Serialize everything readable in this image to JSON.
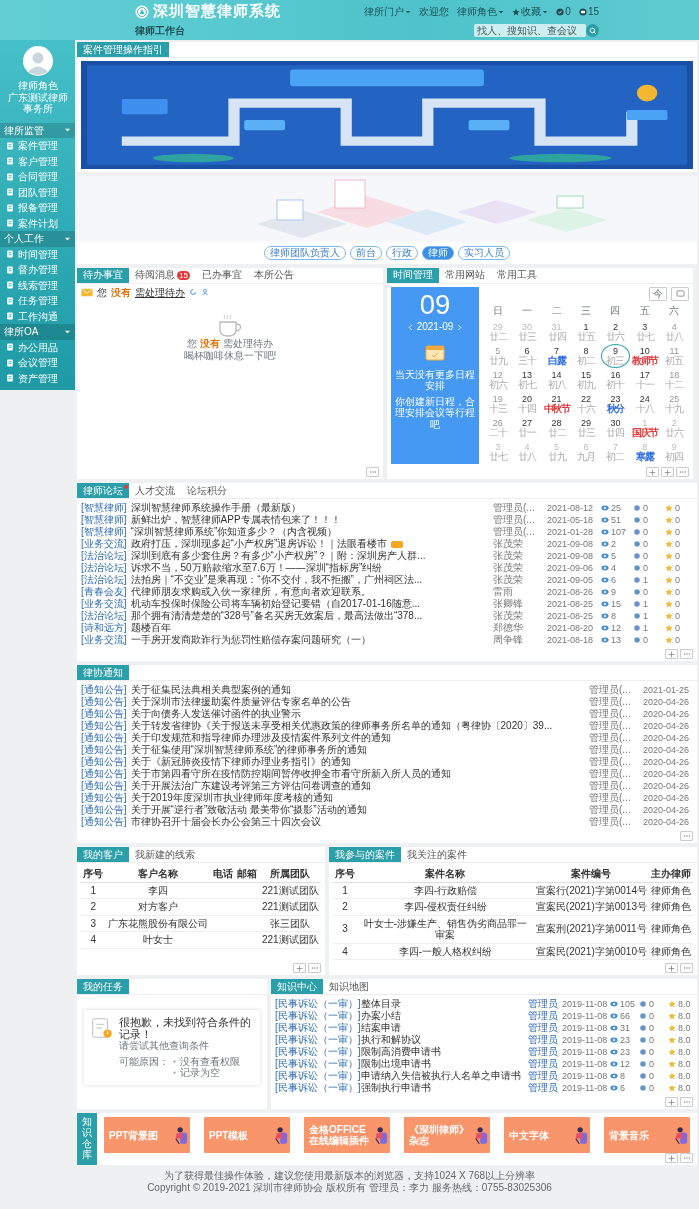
{
  "header": {
    "logo": "深圳智慧律师系统",
    "workbench": "律师工作台",
    "links": [
      {
        "kind": "menu",
        "label": "律所门户"
      },
      {
        "kind": "text",
        "label": "欢迎您"
      },
      {
        "kind": "menu",
        "label": "律师角色"
      },
      {
        "kind": "favorites",
        "label": "收藏"
      },
      {
        "kind": "tasks",
        "label": "0"
      },
      {
        "kind": "messages",
        "label": "15"
      }
    ],
    "search": {
      "placeholder": "找人、搜知识、查会议"
    }
  },
  "sidebar": {
    "user": {
      "name": "律师角色",
      "org": "广东测试律师事务所"
    },
    "groups": [
      {
        "label": "律所监管",
        "expanded": true,
        "items": [
          "案件管理",
          "客户管理",
          "合同管理",
          "团队管理",
          "报备管理",
          "案件计划"
        ]
      },
      {
        "label": "个人工作",
        "expanded": true,
        "items": [
          "时间管理",
          "督办管理",
          "线索管理",
          "任务管理",
          "工作沟通"
        ]
      },
      {
        "label": "律所OA",
        "expanded": true,
        "items": [
          "办公用品",
          "会议管理",
          "资产管理"
        ]
      }
    ]
  },
  "guide": {
    "tabs": [
      {
        "label": "案件管理操作指引",
        "selected": true
      }
    ]
  },
  "roles": [
    {
      "label": "律师团队负责人",
      "selected": false
    },
    {
      "label": "前台",
      "selected": false
    },
    {
      "label": "行政",
      "selected": false
    },
    {
      "label": "律师",
      "selected": true
    },
    {
      "label": "实习人员",
      "selected": false
    }
  ],
  "todo": {
    "tabs": [
      {
        "label": "待办事宜",
        "selected": true
      },
      {
        "label": "待阅消息",
        "selected": false,
        "badge": "15"
      },
      {
        "label": "已办事宜",
        "selected": false
      },
      {
        "label": "本所公告",
        "selected": false
      }
    ],
    "summary": {
      "prefix": "您",
      "count": "没有",
      "link": "需处理待办"
    },
    "empty": [
      "您 **没有** 需处理待办",
      "喝杯咖啡休息一下吧!"
    ]
  },
  "time": {
    "tabs": [
      {
        "label": "时间管理",
        "selected": true
      },
      {
        "label": "常用网站",
        "selected": false
      },
      {
        "label": "常用工具",
        "selected": false
      }
    ],
    "day": "09",
    "month": "2021-09",
    "empty": [
      "当天没有更多日程安排",
      "你创建新日程，合理安排会议等行程吧"
    ],
    "today_button": "今",
    "weekdays": [
      "日",
      "一",
      "二",
      "三",
      "四",
      "五",
      "六"
    ],
    "days": [
      {
        "day": "29",
        "lunar": "廿二",
        "kind": "other",
        "selected": false
      },
      {
        "day": "30",
        "lunar": "廿三",
        "kind": "other",
        "selected": false
      },
      {
        "day": "31",
        "lunar": "廿四",
        "kind": "other",
        "selected": false
      },
      {
        "day": "1",
        "lunar": "廿五",
        "kind": "weekday",
        "selected": false
      },
      {
        "day": "2",
        "lunar": "廿六",
        "kind": "weekday",
        "selected": false
      },
      {
        "day": "3",
        "lunar": "廿七",
        "kind": "weekday",
        "selected": false
      },
      {
        "day": "4",
        "lunar": "廿八",
        "kind": "weekend",
        "selected": false
      },
      {
        "day": "5",
        "lunar": "廿九",
        "kind": "weekend",
        "selected": false
      },
      {
        "day": "6",
        "lunar": "三十",
        "kind": "weekday",
        "selected": false
      },
      {
        "day": "7",
        "lunar": "白露",
        "kind": "weekday",
        "color": "#2d6cdf",
        "selected": false
      },
      {
        "day": "8",
        "lunar": "初二",
        "kind": "weekday",
        "selected": false
      },
      {
        "day": "9",
        "lunar": "初三",
        "kind": "weekday",
        "selected": true
      },
      {
        "day": "10",
        "lunar": "教师节",
        "kind": "weekday",
        "color": "#e4393c",
        "selected": false
      },
      {
        "day": "11",
        "lunar": "初五",
        "kind": "weekend",
        "selected": false
      },
      {
        "day": "12",
        "lunar": "初六",
        "kind": "weekend",
        "selected": false
      },
      {
        "day": "13",
        "lunar": "初七",
        "kind": "weekday",
        "selected": false
      },
      {
        "day": "14",
        "lunar": "初八",
        "kind": "weekday",
        "selected": false
      },
      {
        "day": "15",
        "lunar": "初九",
        "kind": "weekday",
        "selected": false
      },
      {
        "day": "16",
        "lunar": "初十",
        "kind": "weekday",
        "selected": false
      },
      {
        "day": "17",
        "lunar": "十一",
        "kind": "weekday",
        "selected": false
      },
      {
        "day": "18",
        "lunar": "十二",
        "kind": "weekend",
        "selected": false
      },
      {
        "day": "19",
        "lunar": "十三",
        "kind": "weekend",
        "selected": false
      },
      {
        "day": "20",
        "lunar": "十四",
        "kind": "weekday",
        "selected": false
      },
      {
        "day": "21",
        "lunar": "中秋节",
        "kind": "weekday",
        "color": "#e4393c",
        "selected": false
      },
      {
        "day": "22",
        "lunar": "十六",
        "kind": "weekday",
        "selected": false
      },
      {
        "day": "23",
        "lunar": "秋分",
        "kind": "weekday",
        "color": "#2d6cdf",
        "selected": false
      },
      {
        "day": "24",
        "lunar": "十八",
        "kind": "weekday",
        "selected": false
      },
      {
        "day": "25",
        "lunar": "十九",
        "kind": "weekend",
        "selected": false
      },
      {
        "day": "26",
        "lunar": "二十",
        "kind": "weekend",
        "selected": false
      },
      {
        "day": "27",
        "lunar": "廿一",
        "kind": "weekday",
        "selected": false
      },
      {
        "day": "28",
        "lunar": "廿二",
        "kind": "weekday",
        "selected": false
      },
      {
        "day": "29",
        "lunar": "廿三",
        "kind": "weekday",
        "selected": false
      },
      {
        "day": "30",
        "lunar": "廿四",
        "kind": "weekday",
        "selected": false
      },
      {
        "day": "1",
        "lunar": "国庆节",
        "kind": "other",
        "color": "#e4393c",
        "selected": false
      },
      {
        "day": "2",
        "lunar": "廿六",
        "kind": "other",
        "selected": false
      },
      {
        "day": "3",
        "lunar": "廿七",
        "kind": "other",
        "selected": false
      },
      {
        "day": "4",
        "lunar": "廿八",
        "kind": "other",
        "selected": false
      },
      {
        "day": "5",
        "lunar": "廿九",
        "kind": "other",
        "selected": false
      },
      {
        "day": "6",
        "lunar": "九月",
        "kind": "other",
        "selected": false
      },
      {
        "day": "7",
        "lunar": "初二",
        "kind": "other",
        "selected": false
      },
      {
        "day": "8",
        "lunar": "寒露",
        "kind": "other",
        "color": "#2d6cdf",
        "selected": false
      },
      {
        "day": "9",
        "lunar": "初四",
        "kind": "other",
        "selected": false
      }
    ]
  },
  "forum": {
    "tabs": [
      {
        "label": "律师论坛",
        "selected": true,
        "dot": true
      },
      {
        "label": "人才交流",
        "selected": false
      },
      {
        "label": "论坛积分",
        "selected": false
      }
    ],
    "rows": [
      {
        "category": "[智慧律师]",
        "title": "深圳智慧律师系统操作手册（最新版）",
        "author": "管理员(...",
        "date": "2021-08-12",
        "views": "25",
        "replies": "0",
        "score": "0"
      },
      {
        "category": "[智慧律师]",
        "title": "新鲜出炉，智慧律师APP专属表情包来了！！！",
        "author": "管理员(...",
        "date": "2021-05-18",
        "views": "51",
        "replies": "0",
        "score": "0"
      },
      {
        "category": "[智慧律师]",
        "title": "“深圳智慧律师系统”你知道多少？（内含视频）",
        "author": "管理员(...",
        "date": "2021-01-28",
        "views": "107",
        "replies": "0",
        "score": "0"
      },
      {
        "category": "[业务交流]",
        "title": "政府打压，深圳现多起“小产权房”退房诉讼！｜法眼看楼市",
        "author": "张茂荣",
        "date": "2021-09-08",
        "views": "2",
        "replies": "0",
        "score": "0",
        "hot": true
      },
      {
        "category": "[法治论坛]",
        "title": "深圳到底有多少套住房？有多少“小产权房”？｜附：深圳房产人群...",
        "author": "张茂荣",
        "date": "2021-09-08",
        "views": "5",
        "replies": "0",
        "score": "0"
      },
      {
        "category": "[法治论坛]",
        "title": "诉求不当，50万赔款缩水至7.6万！——深圳“指标房”纠纷",
        "author": "张茂荣",
        "date": "2021-09-06",
        "views": "4",
        "replies": "0",
        "score": "0"
      },
      {
        "category": "[法治论坛]",
        "title": "法拍房｜“不交业”是乘再现：“你不交付，我不拒搬”，广州祠区法...",
        "author": "张茂荣",
        "date": "2021-09-05",
        "views": "6",
        "replies": "1",
        "score": "0"
      },
      {
        "category": "[青春会友]",
        "title": "代律师朋友求购或入伙一家律所，有意向者欢迎联系。",
        "author": "雷雨",
        "date": "2021-08-26",
        "views": "9",
        "replies": "0",
        "score": "0"
      },
      {
        "category": "[业务交流]",
        "title": "机动车投保时保险公司将车辆初始登记要错（自2017-01-16随意...",
        "author": "张卿锋",
        "date": "2021-08-25",
        "views": "15",
        "replies": "1",
        "score": "0"
      },
      {
        "category": "[法治论坛]",
        "title": "那个拥有清清楚楚的“328号”备名买房无效案后，最高法做出“378...",
        "author": "张茂荣",
        "date": "2021-08-25",
        "views": "8",
        "replies": "1",
        "score": "0"
      },
      {
        "category": "[诗和远方]",
        "title": "题楼百年",
        "author": "郑德华",
        "date": "2021-08-20",
        "views": "12",
        "replies": "1",
        "score": "0"
      },
      {
        "category": "[业务交流]",
        "title": "一手房开发商欺诈行为惩罚性赔偿存案问题研究（一）",
        "author": "周争锋",
        "date": "2021-08-18",
        "views": "13",
        "replies": "0",
        "score": "0"
      }
    ]
  },
  "notices": {
    "tabs": [
      {
        "label": "律协通知",
        "selected": true
      }
    ],
    "rows": [
      {
        "category": "[通知公告]",
        "title": "关于征集民法典相关典型案例的通知",
        "author": "管理员(...",
        "date": "2021-01-25"
      },
      {
        "category": "[通知公告]",
        "title": "关于深圳市法律援助案件质量评估专家名单的公告",
        "author": "管理员(...",
        "date": "2020-04-26"
      },
      {
        "category": "[通知公告]",
        "title": "关于向债务人发送催讨函件的执业警示",
        "author": "管理员(...",
        "date": "2020-04-26"
      },
      {
        "category": "[通知公告]",
        "title": "关于转发省律协《关于报送未享受相关优惠政策的律师事务所名单的通知（粤律协〔2020〕39...",
        "author": "管理员(...",
        "date": "2020-04-26"
      },
      {
        "category": "[通知公告]",
        "title": "关于印发规范和指导律师办理涉及疫情案件系列文件的通知",
        "author": "管理员(...",
        "date": "2020-04-26"
      },
      {
        "category": "[通知公告]",
        "title": "关于征集使用“深圳智慧律师系统”的律师事务所的通知",
        "author": "管理员(...",
        "date": "2020-04-26"
      },
      {
        "category": "[通知公告]",
        "title": "关于《新冠肺炎疫情下律师办理业务指引》的通知",
        "author": "管理员(...",
        "date": "2020-04-26"
      },
      {
        "category": "[通知公告]",
        "title": "关于市第四看守所在疫情防控期间暂停收押全市看守所新入所人员的通知",
        "author": "管理员(...",
        "date": "2020-04-26"
      },
      {
        "category": "[通知公告]",
        "title": "关于开展法治广东建设考评第三方评估问卷调查的通知",
        "author": "管理员(...",
        "date": "2020-04-26"
      },
      {
        "category": "[通知公告]",
        "title": "关于2019年度深圳市执业律师年度考核的通知",
        "author": "管理员(...",
        "date": "2020-04-26"
      },
      {
        "category": "[通知公告]",
        "title": "关于开展“逆行者”致敬活动 最美带你“摄影”活动的通知",
        "author": "管理员(...",
        "date": "2020-04-26"
      },
      {
        "category": "[通知公告]",
        "title": "市律协召开十届会长办公会第三十四次会议",
        "author": "管理员(...",
        "date": "2020-04-26"
      }
    ]
  },
  "customers": {
    "tabs": [
      {
        "label": "我的客户",
        "selected": true
      },
      {
        "label": "我新建的线索",
        "selected": false
      }
    ],
    "columns": [
      "序号",
      "客户名称",
      "电话",
      "邮箱",
      "所属团队"
    ],
    "rows": [
      [
        "1",
        "李四",
        "",
        "",
        "221测试团队"
      ],
      [
        "2",
        "对方客户",
        "",
        "",
        "221测试团队"
      ],
      [
        "3",
        "广东花熊股份有限公司",
        "",
        "",
        "张三团队"
      ],
      [
        "4",
        "叶女士",
        "",
        "",
        "221测试团队"
      ]
    ]
  },
  "cases": {
    "tabs": [
      {
        "label": "我参与的案件",
        "selected": true
      },
      {
        "label": "我关注的案件",
        "selected": false
      }
    ],
    "columns": [
      "序号",
      "案件名称",
      "案件编号",
      "主办律师"
    ],
    "rows": [
      [
        "1",
        "李四-行政赔偿",
        "宣案行(2021)字第0014号",
        "律师角色"
      ],
      [
        "2",
        "李四-侵权责任纠纷",
        "宣案民(2021)字第0013号",
        "律师角色"
      ],
      [
        "3",
        "叶女士-涉嫌生产、销售伪劣商品罪一审案",
        "宣案刑(2021)字第0011号",
        "律师角色"
      ],
      [
        "4",
        "李四-一般人格权纠纷",
        "宣案民(2021)字第0010号",
        "律师角色"
      ]
    ]
  },
  "tasks": {
    "tabs": [
      {
        "label": "我的任务",
        "selected": true
      }
    ],
    "empty": {
      "title": "很抱歉，未找到符合条件的记录！",
      "hint": "请尝试其他查询条件",
      "reasons_label": "可能原因：",
      "reasons": [
        "没有查看权限",
        "记录为空"
      ]
    }
  },
  "knowledge": {
    "tabs": [
      {
        "label": "知识中心",
        "selected": true
      },
      {
        "label": "知识地图",
        "selected": false
      }
    ],
    "rows": [
      {
        "category": "[民事诉讼（一审）]",
        "title": "整体目录",
        "author": "管理员",
        "date": "2019-11-08",
        "views": "105",
        "replies": "0",
        "score": "8.0"
      },
      {
        "category": "[民事诉讼（一审）]",
        "title": "办案小结",
        "author": "管理员",
        "date": "2019-11-08",
        "views": "66",
        "replies": "0",
        "score": "8.0"
      },
      {
        "category": "[民事诉讼（一审）]",
        "title": "结案申请",
        "author": "管理员",
        "date": "2019-11-08",
        "views": "31",
        "replies": "0",
        "score": "8.0"
      },
      {
        "category": "[民事诉讼（一审）]",
        "title": "执行和解协议",
        "author": "管理员",
        "date": "2019-11-08",
        "views": "23",
        "replies": "0",
        "score": "8.0"
      },
      {
        "category": "[民事诉讼（一审）]",
        "title": "限制高消费申请书",
        "author": "管理员",
        "date": "2019-11-08",
        "views": "23",
        "replies": "0",
        "score": "8.0"
      },
      {
        "category": "[民事诉讼（一审）]",
        "title": "限制出境申请书",
        "author": "管理员",
        "date": "2019-11-08",
        "views": "12",
        "replies": "0",
        "score": "8.0"
      },
      {
        "category": "[民事诉讼（一审）]",
        "title": "申请纳入失信被执行人名单之申请书",
        "author": "管理员",
        "date": "2019-11-08",
        "views": "8",
        "replies": "0",
        "score": "8.0"
      },
      {
        "category": "[民事诉讼（一审）]",
        "title": "强制执行申请书",
        "author": "管理员",
        "date": "2019-11-08",
        "views": "6",
        "replies": "0",
        "score": "8.0"
      }
    ]
  },
  "warehouse": {
    "title": "知识仓库",
    "tiles": [
      {
        "lines": [
          "PPT背景图"
        ]
      },
      {
        "lines": [
          "PPT模板"
        ]
      },
      {
        "lines": [
          "金格OFFICE",
          "在线编辑插件"
        ]
      },
      {
        "lines": [
          "《深圳律师》杂志"
        ]
      },
      {
        "lines": [
          "中文字体"
        ]
      },
      {
        "lines": [
          "背景音乐"
        ]
      }
    ]
  },
  "footer": [
    "为了获得最佳操作体验，建议您使用最新版本的浏览器，支持1024 X 768以上分辨率",
    "Copyright © 2019-2021 深圳市律师协会 版权所有 管理员：李力 服务热线：0755-83025306"
  ]
}
